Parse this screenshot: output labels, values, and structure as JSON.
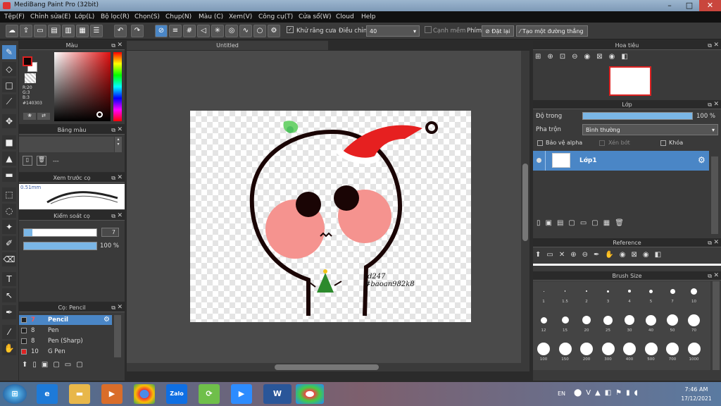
{
  "window": {
    "title": "MediBang Paint Pro (32bit)",
    "controls": [
      "–",
      "□",
      "✕"
    ]
  },
  "menu": [
    "Tệp(F)",
    "Chỉnh sửa(E)",
    "Lớp(L)",
    "Bộ lọc(R)",
    "Chọn(S)",
    "Chụp(N)",
    "Màu (C)",
    "Xem(V)",
    "Công cụ(T)",
    "Cửa sổ(W)",
    "Cloud",
    "Help"
  ],
  "toolbar": {
    "antialias_label": "Khử răng cưa",
    "adjust_label": "Điều chỉnh",
    "adjust_value": "40",
    "edge_label": "Cạnh mềm",
    "key_label": "Phím",
    "reset_label": "Đặt lại",
    "line_label": "Tạo một đường thẳng"
  },
  "color_panel": {
    "title": "Màu",
    "rgb": "R:20\nG:3\nB:3",
    "hex": "#140303",
    "fg_color": "#140303",
    "bg_color": "#ffffff"
  },
  "palette_panel": {
    "title": "Bảng màu",
    "dash": "---"
  },
  "brush_preview": {
    "title": "Xem trước cọ",
    "size": "0.51mm"
  },
  "brush_control": {
    "title": "Kiểm soát cọ",
    "size_value": "7",
    "opacity_value": "100 %"
  },
  "brush_list": {
    "title": "Cọ: Pencil",
    "items": [
      {
        "size": "7",
        "name": "Pencil",
        "color": "#222222"
      },
      {
        "size": "8",
        "name": "Pen",
        "color": "#222222"
      },
      {
        "size": "8",
        "name": "Pen (Sharp)",
        "color": "#222222"
      },
      {
        "size": "10",
        "name": "G Pen",
        "color": "#dd2222"
      }
    ]
  },
  "document": {
    "tab": "Untitled",
    "signature": "td247\n#baoan982k8"
  },
  "navigator": {
    "title": "Hoa tiêu"
  },
  "layer_panel": {
    "title": "Lớp",
    "opacity_label": "Độ trong",
    "opacity_value": "100 %",
    "opacity": 1.0,
    "blend_label": "Pha trộn",
    "blend_value": "Bình thường",
    "protect_alpha": "Bảo vệ alpha",
    "clipping": "Xén bớt",
    "lock": "Khóa",
    "layer_name": "Lớp1"
  },
  "reference_panel": {
    "title": "Reference"
  },
  "brush_size_panel": {
    "title": "Brush Size",
    "sizes": [
      "1",
      "1.5",
      "2",
      "3",
      "4",
      "5",
      "7",
      "10",
      "12",
      "15",
      "20",
      "25",
      "30",
      "40",
      "50",
      "70",
      "100",
      "150",
      "200",
      "300",
      "400",
      "500",
      "700",
      "1000"
    ]
  },
  "taskbar": {
    "time": "7:46 AM",
    "date": "17/12/2021",
    "lang": "EN",
    "apps": [
      "Zalo",
      "W"
    ]
  }
}
